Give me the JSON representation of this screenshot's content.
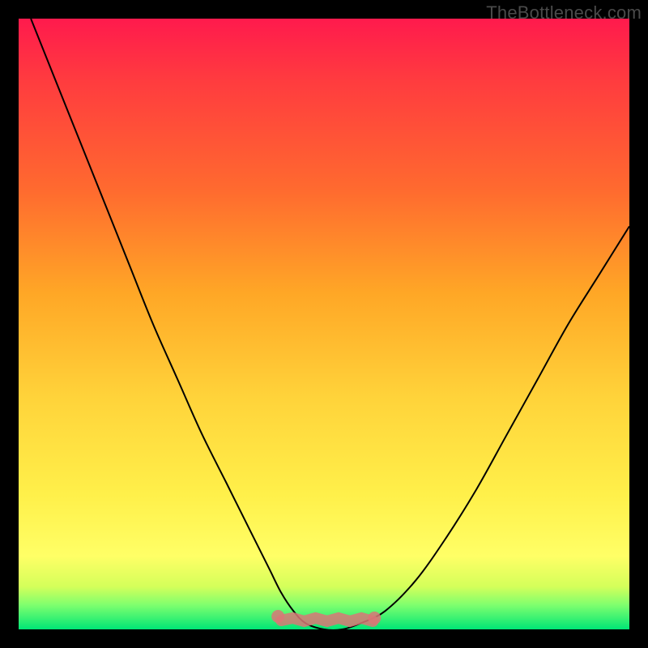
{
  "watermark": "TheBottleneck.com",
  "colors": {
    "background_black": "#000000",
    "gradient_top": "#ff1a4d",
    "gradient_bottom": "#00e676",
    "curve": "#000000",
    "strip": "#d97777"
  },
  "chart_data": {
    "type": "line",
    "title": "",
    "xlabel": "",
    "ylabel": "",
    "xlim": [
      0,
      100
    ],
    "ylim": [
      0,
      100
    ],
    "x": [
      2,
      6,
      10,
      14,
      18,
      22,
      26,
      30,
      34,
      38,
      41,
      43,
      45,
      47,
      50,
      53,
      56,
      60,
      65,
      70,
      75,
      80,
      85,
      90,
      95,
      100
    ],
    "values": [
      100,
      90,
      80,
      70,
      60,
      50,
      41,
      32,
      24,
      16,
      10,
      6,
      3,
      1,
      0,
      0,
      1,
      3,
      8,
      15,
      23,
      32,
      41,
      50,
      58,
      66
    ],
    "series": [
      {
        "name": "bottleneck-curve",
        "x": [
          2,
          6,
          10,
          14,
          18,
          22,
          26,
          30,
          34,
          38,
          41,
          43,
          45,
          47,
          50,
          53,
          56,
          60,
          65,
          70,
          75,
          80,
          85,
          90,
          95,
          100
        ],
        "y": [
          100,
          90,
          80,
          70,
          60,
          50,
          41,
          32,
          24,
          16,
          10,
          6,
          3,
          1,
          0,
          0,
          1,
          3,
          8,
          15,
          23,
          32,
          41,
          50,
          58,
          66
        ]
      }
    ],
    "highlight_range_x": [
      43,
      58
    ],
    "grid": false,
    "legend": false
  }
}
